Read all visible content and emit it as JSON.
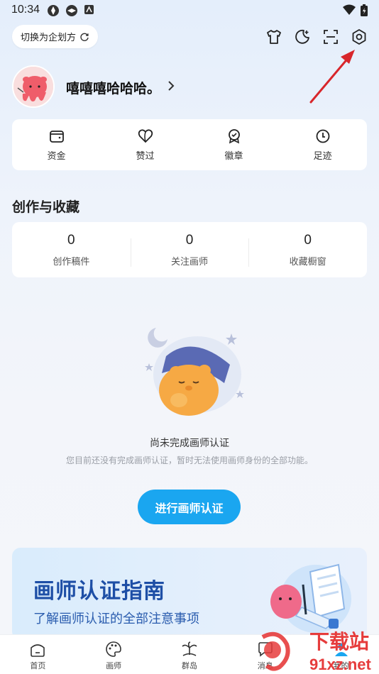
{
  "status_bar": {
    "time": "10:34"
  },
  "topbar": {
    "switch_label": "切换为企划方",
    "icons": [
      "shirt-icon",
      "moon-plus-icon",
      "scan-icon",
      "gear-icon"
    ]
  },
  "profile": {
    "username": "嘻嘻嘻哈哈哈。"
  },
  "quick_actions": [
    {
      "label": "资金",
      "icon": "wallet-icon"
    },
    {
      "label": "赞过",
      "icon": "heart-icon"
    },
    {
      "label": "徽章",
      "icon": "badge-icon"
    },
    {
      "label": "足迹",
      "icon": "clock-icon"
    }
  ],
  "creation": {
    "title": "创作与收藏",
    "stats": [
      {
        "value": "0",
        "label": "创作稿件"
      },
      {
        "value": "0",
        "label": "关注画师"
      },
      {
        "value": "0",
        "label": "收藏橱窗"
      }
    ]
  },
  "empty_state": {
    "title": "尚未完成画师认证",
    "description": "您目前还没有完成画师认证，暂时无法使用画师身份的全部功能。",
    "button": "进行画师认证"
  },
  "guide": {
    "title": "画师认证指南",
    "subtitle": "了解画师认证的全部注意事项"
  },
  "bottom_nav": [
    {
      "label": "首页",
      "icon": "home-icon"
    },
    {
      "label": "画师",
      "icon": "palette-icon"
    },
    {
      "label": "群岛",
      "icon": "island-icon"
    },
    {
      "label": "消息",
      "icon": "message-icon"
    },
    {
      "label": "我的",
      "icon": "profile-icon"
    }
  ],
  "watermark": {
    "main": "下载站",
    "site": "91xz.net"
  },
  "colors": {
    "accent": "#1aa6f0",
    "guide_title": "#1e4fa6",
    "annotation_arrow": "#d8262b"
  }
}
